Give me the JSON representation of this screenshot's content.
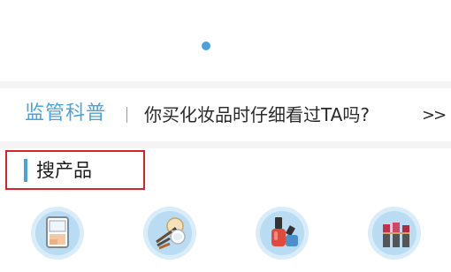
{
  "colors": {
    "accent": "#4aa3df",
    "indicator_dot": "#4aa3df",
    "highlight_box": "#d8232a"
  },
  "carousel": {
    "indicator_count": 1,
    "active_index": 0
  },
  "news_ticker": {
    "brand": "监管科普",
    "headline": "你买化妆品时仔细看过TA吗?",
    "more": ">>"
  },
  "product_search": {
    "title": "搜产品",
    "categories": [
      {
        "icon": "compact-powder-icon"
      },
      {
        "icon": "makeup-brushes-icon"
      },
      {
        "icon": "nail-polish-icon"
      },
      {
        "icon": "lipstick-icon"
      }
    ]
  }
}
